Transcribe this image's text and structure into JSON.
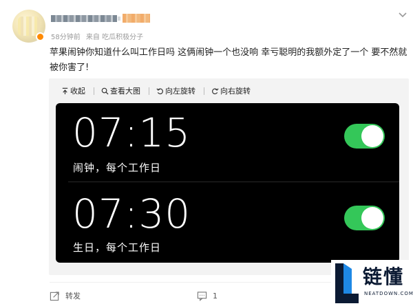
{
  "post": {
    "time": "58分钟前",
    "source": "来自 吃瓜积极分子",
    "text": "苹果闹钟你知道什么叫工作日吗 这俩闹钟一个也没响 幸亏聪明的我额外定了一个 要不然就被你害了!"
  },
  "toolbar": {
    "collapse_label": "收起",
    "view_large_label": "查看大图",
    "rotate_left_label": "向左旋转",
    "rotate_right_label": "向右旋转"
  },
  "alarms": [
    {
      "time": "07:15",
      "label": "闹钟，每个工作日",
      "enabled": true
    },
    {
      "time": "07:30",
      "label": "生日，每个工作日",
      "enabled": true
    }
  ],
  "actions": {
    "repost_label": "转发",
    "comment_count": "1"
  },
  "watermark": {
    "cn": "链懂",
    "en": "NEATDOWN.COM"
  },
  "colors": {
    "toggle_on": "#34c759",
    "phone_bg": "#000000",
    "verify_badge": "#ff8a00"
  },
  "icons": [
    "more-chevron-icon",
    "collapse-icon",
    "zoom-icon",
    "rotate-left-icon",
    "rotate-right-icon",
    "repost-icon",
    "comment-icon"
  ]
}
